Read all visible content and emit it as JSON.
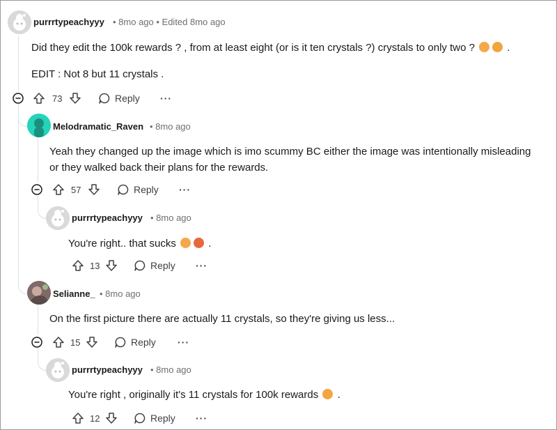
{
  "comments": [
    {
      "author": "purrrtypeachyyy",
      "meta": "• 8mo ago • Edited 8mo ago",
      "body_line1": "Did they edit the 100k rewards ? , from at least eight (or is it ten crystals ?) crystals to only two ?",
      "body_line1_suffix": ".",
      "body_line2": "EDIT : Not 8 but 11 crystals .",
      "votes": "73",
      "reply_label": "Reply",
      "more_label": "···"
    },
    {
      "author": "Melodramatic_Raven",
      "meta": "• 8mo ago",
      "body_line1": "Yeah they changed up the image which is imo scummy BC either the image was intentionally misleading",
      "body_line2": "or they walked back their plans for the rewards.",
      "votes": "57",
      "reply_label": "Reply",
      "more_label": "···"
    },
    {
      "author": "purrrtypeachyyy",
      "meta": "• 8mo ago",
      "body_line1": "You're right.. that sucks",
      "body_line1_suffix": ".",
      "votes": "13",
      "reply_label": "Reply",
      "more_label": "···"
    },
    {
      "author": "Selianne_",
      "meta": "• 8mo ago",
      "body_line1": "On the first picture there are actually 11 crystals, so they're giving us less...",
      "votes": "15",
      "reply_label": "Reply",
      "more_label": "···"
    },
    {
      "author": "purrrtypeachyyy",
      "meta": "• 8mo ago",
      "body_line1": "You're right , originally it's 11 crystals for 100k rewards",
      "body_line1_suffix": ".",
      "votes": "12",
      "reply_label": "Reply",
      "more_label": "···"
    }
  ],
  "icons": {
    "upvote": "upvote-icon",
    "downvote": "downvote-icon",
    "reply": "reply-bubble-icon",
    "collapse": "collapse-minus-icon",
    "emoji_flushed": "flushed-face-emoji",
    "emoji_sad": "sad-face-emoji",
    "emoji_tongue": "tongue-face-emoji"
  },
  "colors": {
    "thread_line": "#d5e4e4",
    "meta_text": "#6b6f72",
    "avatar_teal": "#24d4b8",
    "avatar_default": "#cfcfcf"
  }
}
